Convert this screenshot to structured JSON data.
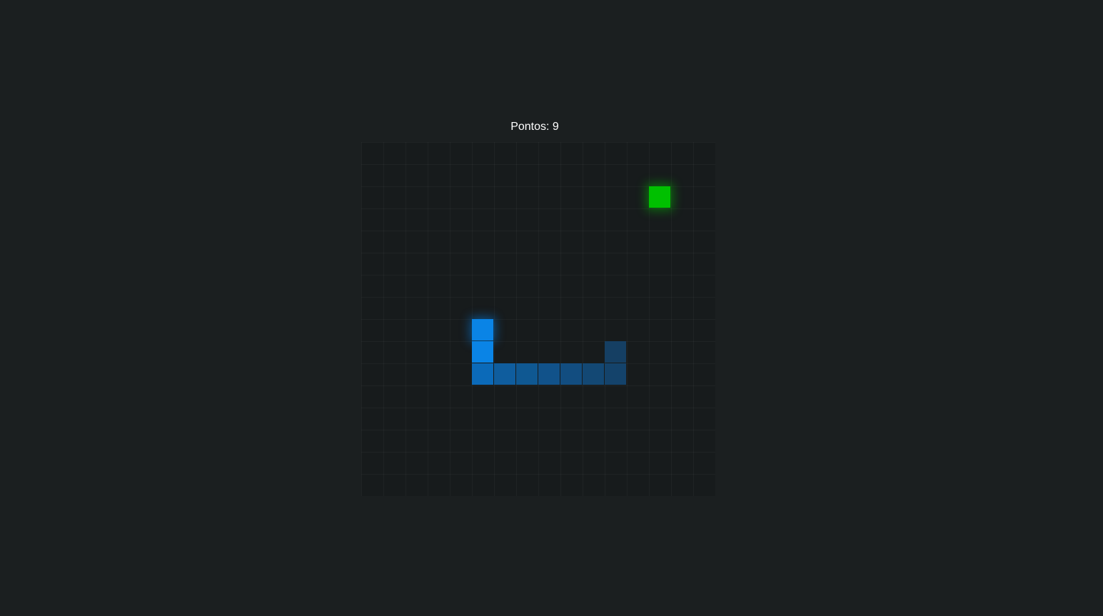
{
  "score": {
    "label": "Pontos: 9"
  },
  "board": {
    "columns": 16,
    "rows": 16
  },
  "food": {
    "col": 13,
    "row": 2,
    "color": "#00c000"
  },
  "snake": {
    "segments": [
      {
        "col": 5,
        "row": 8,
        "color": "#0a84e6"
      },
      {
        "col": 5,
        "row": 9,
        "color": "#0a84e6"
      },
      {
        "col": 5,
        "row": 10,
        "color": "#0b6ab9"
      },
      {
        "col": 6,
        "row": 10,
        "color": "#0f5d9e"
      },
      {
        "col": 7,
        "row": 10,
        "color": "#0f5892"
      },
      {
        "col": 8,
        "row": 10,
        "color": "#11528a"
      },
      {
        "col": 9,
        "row": 10,
        "color": "#124d80"
      },
      {
        "col": 10,
        "row": 10,
        "color": "#134874"
      },
      {
        "col": 11,
        "row": 10,
        "color": "#14436b"
      },
      {
        "col": 11,
        "row": 9,
        "color": "#153f63"
      }
    ]
  }
}
